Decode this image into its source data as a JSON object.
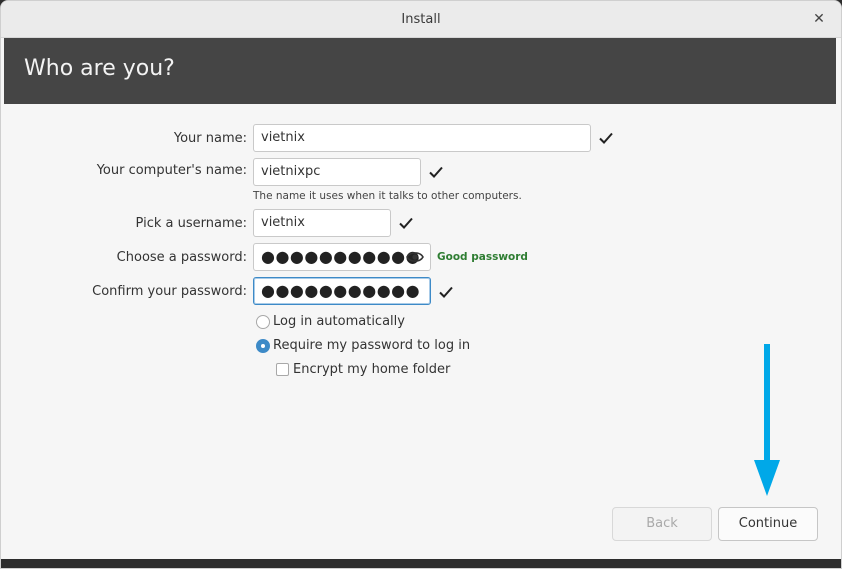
{
  "window": {
    "title": "Install",
    "close_glyph": "✕"
  },
  "header": {
    "title": "Who are you?"
  },
  "form": {
    "your_name_label": "Your name:",
    "your_name_value": "vietnix",
    "computer_name_label": "Your computer's name:",
    "computer_name_value": "vietnixpc",
    "computer_name_hint": "The name it uses when it talks to other computers.",
    "username_label": "Pick a username:",
    "username_value": "vietnix",
    "password_label": "Choose a password:",
    "password_value": "●●●●●●●●●●●",
    "password_strength": "Good password",
    "confirm_label": "Confirm your password:",
    "confirm_value": "●●●●●●●●●●●"
  },
  "options": {
    "login_auto": "Log in automatically",
    "require_password": "Require my password to log in",
    "encrypt_home": "Encrypt my home folder",
    "selected": "require_password",
    "encrypt_checked": false
  },
  "buttons": {
    "back": "Back",
    "continue": "Continue"
  },
  "colors": {
    "accent": "#3d8ac7",
    "good": "#2e7d32",
    "annotation_arrow": "#00a8e8"
  },
  "icons": [
    "check-icon",
    "eye-icon",
    "close-icon",
    "arrow-down-icon"
  ]
}
